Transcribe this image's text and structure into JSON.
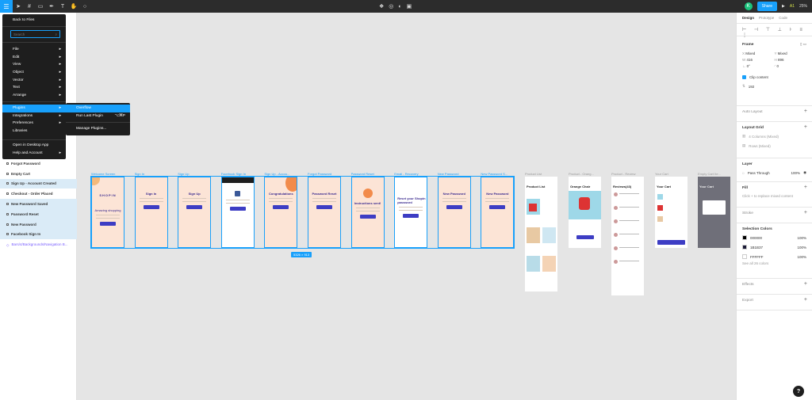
{
  "toolbar": {
    "menu_icon": "hamburger-icon",
    "share_label": "Share",
    "avatar_initial": "K",
    "aa_label": "A1",
    "zoom": "25%"
  },
  "menu": {
    "back": "Back to Files",
    "search_placeholder": "Search",
    "items": [
      "File",
      "Edit",
      "View",
      "Object",
      "Vector",
      "Text",
      "Arrange"
    ],
    "items2": [
      "Plugins",
      "Integrations",
      "Preferences",
      "Libraries"
    ],
    "items3": [
      "Open in Desktop App",
      "Help and Account"
    ],
    "arrow": "▸"
  },
  "submenu": {
    "overflow": "Overflow",
    "run_last": "Run Last Plugin",
    "run_last_shortcut": "⌥⌘P",
    "manage": "Manage Plugins..."
  },
  "layers": [
    {
      "name": "Forgot Password",
      "selected": false
    },
    {
      "name": "Empty Cart",
      "selected": false
    },
    {
      "name": "Sign Up - Account Created",
      "selected": true
    },
    {
      "name": "Checkout - Order Placed",
      "selected": false
    },
    {
      "name": "New Password Saved",
      "selected": true
    },
    {
      "name": "Password Reset",
      "selected": true
    },
    {
      "name": "New Password",
      "selected": true
    },
    {
      "name": "Facebook Sign In",
      "selected": true
    },
    {
      "name": "Bars/4/Backgrounds/Navigation B...",
      "selected": false
    }
  ],
  "frames": [
    {
      "label": "Welcome Screen",
      "title": "SHOPIN",
      "sub": "Amazing shopping"
    },
    {
      "label": "Sign In",
      "title": "Sign In",
      "sub": ""
    },
    {
      "label": "Sign Up",
      "title": "Sign Up",
      "sub": ""
    },
    {
      "label": "Facebook Sign In",
      "title": "",
      "sub": ""
    },
    {
      "label": "Sign Up - Accou...",
      "title": "Congratulations",
      "sub": ""
    },
    {
      "label": "Forgot Password",
      "title": "Password Reset",
      "sub": ""
    },
    {
      "label": "Password Reset",
      "title": "Instructions sent!",
      "sub": ""
    },
    {
      "label": "Email - Recovery",
      "title": "Reset your Shopin password",
      "sub": ""
    },
    {
      "label": "New Password",
      "title": "New Password",
      "sub": ""
    },
    {
      "label": "New Password S...",
      "title": "New Password",
      "sub": ""
    }
  ],
  "frames_grey": [
    {
      "label": "Product List",
      "title": "Product List"
    },
    {
      "label": "Product - Orang...",
      "title": "Orange Chair"
    },
    {
      "label": "Product - Review",
      "title": "Reviews(43)"
    },
    {
      "label": "Your Cart",
      "title": "Your Cart"
    },
    {
      "label": "Empty Cart Ite...",
      "title": "Your Cart"
    }
  ],
  "dimension_label": "5326 × 913",
  "help_label": "?",
  "right_panel": {
    "tabs": [
      "Design",
      "Prototype",
      "Code"
    ],
    "frame_label": "Frame",
    "x": "Mixed",
    "y": "Mixed",
    "w": "416",
    "h": "896",
    "rotation": "0°",
    "radius": "0",
    "clip_content": "Clip content",
    "spacing": "192",
    "auto_layout": "Auto Layout",
    "layout_grid": "Layout Grid",
    "grid1": "4 Columns (Mixed)",
    "grid2": "Rows (Mixed)",
    "layer": "Layer",
    "blend": "Pass Through",
    "opacity": "100%",
    "fill": "Fill",
    "fill_hint": "Click + to replace mixed content",
    "stroke": "Stroke",
    "selection_colors": "Selection Colors",
    "colors": [
      {
        "hex": "000000",
        "opacity": "100%",
        "color": "#000000"
      },
      {
        "hex": "1B1B37",
        "opacity": "100%",
        "color": "#1b1b37"
      },
      {
        "hex": "FFFFFF",
        "opacity": "100%",
        "color": "#ffffff"
      }
    ],
    "see_all": "See all 26 colors",
    "effects": "Effects",
    "export": "Export"
  }
}
